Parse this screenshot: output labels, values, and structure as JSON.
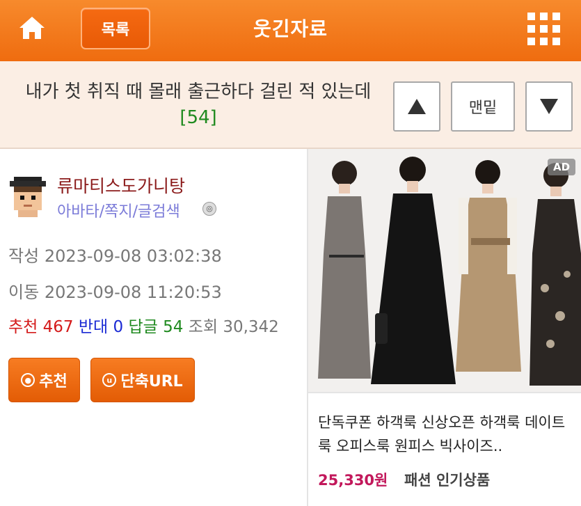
{
  "header": {
    "list_label": "목록",
    "title": "웃긴자료"
  },
  "post": {
    "title": "내가 첫 취직 때 몰래 출근하다 걸린 적 있는데",
    "reply_count": "[54]"
  },
  "nav": {
    "bottom_label": "맨밑"
  },
  "author": {
    "name": "류마티스도가니탕",
    "links": "아바타/쪽지/글검색"
  },
  "meta": {
    "created_label": "작성",
    "created": "2023-09-08 03:02:38",
    "moved_label": "이동",
    "moved": "2023-09-08 11:20:53"
  },
  "stats": {
    "recommend_label": "추천",
    "recommend": "467",
    "oppose_label": "반대",
    "oppose": "0",
    "reply_label": "답글",
    "reply": "54",
    "views_label": "조회",
    "views": "30,342"
  },
  "buttons": {
    "recommend": "추천",
    "short_url": "단축URL"
  },
  "ad": {
    "tag": "AD",
    "description": "단독쿠폰 하객룩 신상오픈 하객룩 데이트룩 오피스룩 원피스 빅사이즈..",
    "price": "25,330원",
    "category": "패션 인기상품"
  },
  "colors": {
    "header_orange": "#ef6c0f",
    "title_bg": "#fbeee4",
    "reply_green": "#1f8a1f",
    "author_red": "#8b1a1a",
    "price_pink": "#c2185b"
  },
  "icons": [
    "home-icon",
    "grid-menu-icon",
    "arrow-up-icon",
    "arrow-down-icon",
    "avatar-icon",
    "recommend-icon",
    "short-url-icon"
  ]
}
